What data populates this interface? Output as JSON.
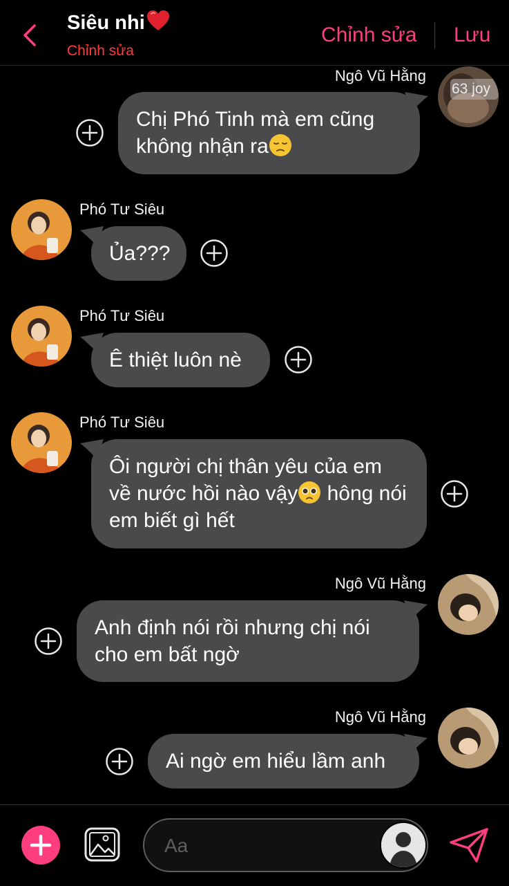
{
  "header": {
    "title": "Siêu nhi",
    "subtitle": "Chỉnh sửa",
    "edit_label": "Chỉnh sửa",
    "save_label": "Lưu"
  },
  "messages": [
    {
      "sender": "Ngô Vũ Hằng",
      "text": "Chị Phó Tinh mà em cũng không nhận ra",
      "emoji": "pensive",
      "side": "right",
      "avatar_badge": "63 joy"
    },
    {
      "sender": "Phó Tư Siêu",
      "text": "Ủa???",
      "side": "left"
    },
    {
      "sender": "Phó Tư Siêu",
      "text": "Ê thiệt luôn nè",
      "side": "left"
    },
    {
      "sender": "Phó Tư Siêu",
      "text_before": "Ôi người chị thân yêu của em về nước hồi nào vậy",
      "emoji": "pleading",
      "text_after": " hông nói em biết gì hết",
      "side": "left"
    },
    {
      "sender": "Ngô Vũ Hằng",
      "text": "Anh định nói rồi nhưng chị nói cho em bất ngờ",
      "side": "right"
    },
    {
      "sender": "Ngô Vũ Hằng",
      "text": "Ai ngờ em hiểu lầm anh",
      "side": "right"
    }
  ],
  "composer": {
    "placeholder": "Aa"
  },
  "colors": {
    "accent": "#ff3d7f",
    "subtitle": "#ff3b3b",
    "bubble": "#4a4a4c",
    "background": "#000000"
  },
  "icons": [
    "chevron-left-icon",
    "heart-icon",
    "plus-circle-icon",
    "add-icon",
    "gallery-icon",
    "send-icon",
    "avatar-icon"
  ]
}
